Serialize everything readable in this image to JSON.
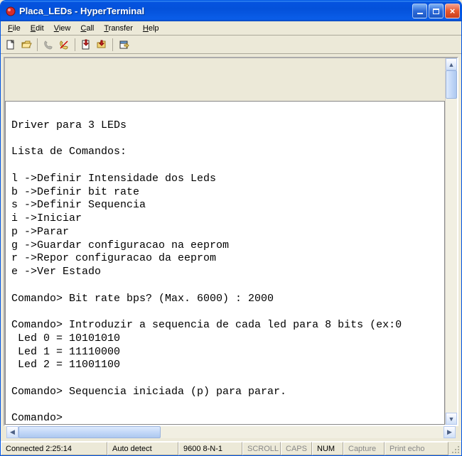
{
  "window": {
    "title": "Placa_LEDs - HyperTerminal"
  },
  "menu": {
    "file": "File",
    "edit": "Edit",
    "view": "View",
    "call": "Call",
    "transfer": "Transfer",
    "help": "Help"
  },
  "terminal": {
    "lines": [
      "",
      "Driver para 3 LEDs",
      "",
      "Lista de Comandos:",
      "",
      "l ->Definir Intensidade dos Leds",
      "b ->Definir bit rate",
      "s ->Definir Sequencia",
      "i ->Iniciar",
      "p ->Parar",
      "g ->Guardar configuracao na eeprom",
      "r ->Repor configuracao da eeprom",
      "e ->Ver Estado",
      "",
      "Comando> Bit rate bps? (Max. 6000) : 2000",
      "",
      "Comando> Introduzir a sequencia de cada led para 8 bits (ex:0",
      " Led 0 = 10101010",
      " Led 1 = 11110000",
      " Led 2 = 11001100",
      "",
      "Comando> Sequencia iniciada (p) para parar.",
      "",
      "Comando>"
    ]
  },
  "status": {
    "connected": "Connected 2:25:14",
    "autodetect": "Auto detect",
    "port": "9600 8-N-1",
    "scroll": "SCROLL",
    "caps": "CAPS",
    "num": "NUM",
    "capture": "Capture",
    "printecho": "Print echo"
  }
}
